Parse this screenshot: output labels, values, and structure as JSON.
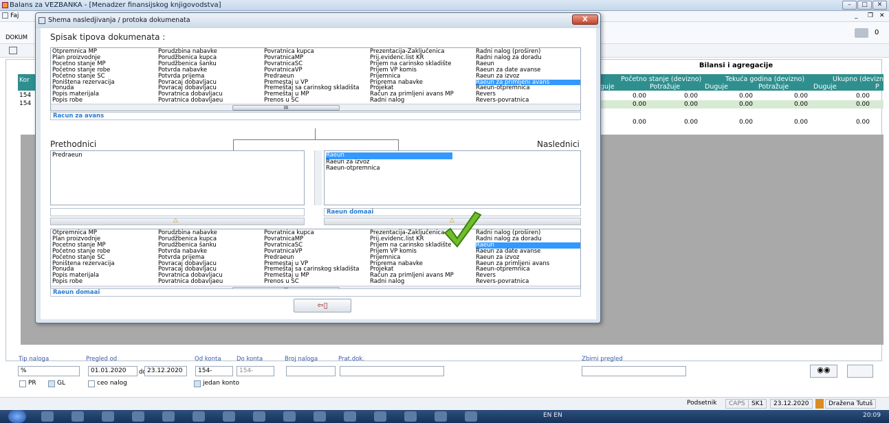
{
  "window": {
    "title": "Balans za VEZBANKA - [Menadzer finansijskog knjigovodstva]",
    "min": "–",
    "max": "□",
    "close": "✕"
  },
  "menubar": {
    "item1": "Faj",
    "mdi_min": "_",
    "mdi_max": "❐",
    "mdi_close": "✕"
  },
  "toolbar": {
    "dokum": "DOKUM",
    "messages_count": "0"
  },
  "main": {
    "bilansi_title": "Bilansi i agregacije",
    "left_head": "Kor",
    "left_rows": [
      "154",
      "154"
    ],
    "groups": [
      "Početno stanje (devizno)",
      "Tekuća godina (devizno)",
      "Ukupno (devizno)"
    ],
    "subheads": [
      "uguje",
      "Potražuje",
      "Duguje",
      "Potražuje",
      "Duguje",
      "P"
    ],
    "rows": [
      [
        "0.00",
        "0.00",
        "0.00",
        "0.00",
        "0.00"
      ],
      [
        "0.00",
        "0.00",
        "0.00",
        "0.00",
        "0.00"
      ],
      [
        "0.00",
        "0.00",
        "0.00",
        "0.00",
        "0.00"
      ]
    ]
  },
  "dialog": {
    "title": "Shema nasledjivanja / protoka dokumenata",
    "close": "X",
    "spisak_label": "Spisak tipova dokumenata :",
    "doc_columns": [
      [
        "Otpremnica MP",
        "Plan proizvodnje",
        "Pocetno stanje MP",
        "Početno stanje robe",
        "Početno stanje SC",
        "Poništena rezervacija",
        "Ponuda",
        "Popis materijala",
        "Popis robe"
      ],
      [
        "Porudzbina nabavke",
        "Porudžbenica kupca",
        "Porudžbenica šanku",
        "Potvrda nabavke",
        "Potvrda prijema",
        "Povracaj dobavljacu",
        "Povracaj dobavljacu",
        "Povratnica dobavljacu",
        "Povratnica dobavljaeu"
      ],
      [
        "Povratnica kupca",
        "PovratnicaMP",
        "PovratnicaSC",
        "PovratnicaVP",
        "Predraeun",
        "Premestaj u VP",
        "Premeštaj sa carinskog skladišta",
        "Premeštaj u MP",
        "Prenos u SC"
      ],
      [
        "Prezentacija-Zaključenica",
        "Prij.evidenc.list KR",
        "Prijem na carinsko skladište",
        "Prijem VP komis",
        "Prijemnica",
        "Priprema nabavke",
        "Projekat",
        "Račun za primljeni avans MP",
        "Radni nalog"
      ],
      [
        "Radni nalog (proširen)",
        "Radni nalog za doradu",
        "Raeun",
        "Raeun za date avanse",
        "Raeun za izvoz",
        "Raeun za primljeni avans",
        "Raeun-otpremnica",
        "Revers",
        "Revers-povratnica"
      ]
    ],
    "doc_columns_bottom_c2": [
      "Porudzbina nabavke",
      "Porudžbenica kupca",
      "Porudžbenica šanku",
      "Potvrda nabavke",
      "Potvrda prijema",
      "Povracaj dobavljacu",
      "Povracaj dobavljacu",
      "Povratnica dobavljacu",
      "Povratnica dobavljaeu"
    ],
    "doc_columns_bottom_c3": [
      "Povratnica kupca",
      "PovratnicaMP",
      "PovratnicaSC",
      "PovratnicaVP",
      "Predraeun",
      "Premestaj u VP",
      "Premeštaj sa carinskog skladišta",
      "Premeštaj u MP",
      "Prenos u SC"
    ],
    "doc_columns_bottom_c4": [
      "Prezentacija-Zaključenica",
      "Prij.evidenc.list KR",
      "Prijem na carinsko skladište",
      "Prijem VP komis",
      "Prijemnica",
      "Priprema nabavke",
      "Projekat",
      "Račun za primljeni avans MP",
      "Radni nalog"
    ],
    "doc_columns_bottom_c5": [
      "Radni nalog (proširen)",
      "Radni nalog za doradu",
      "Raeun",
      "Raeun za date avanse",
      "Raeun za izvoz",
      "Raeun za primljeni avans",
      "Raeun-otpremnica",
      "Revers",
      "Revers-povratnica"
    ],
    "top_selected": "Racun za avans",
    "prethodnici_label": "Prethodnici",
    "naslednici_label": "Naslednici",
    "prethodnici_items": [
      "Predraeun"
    ],
    "naslednici_items": [
      "Raeun",
      "Raeun za izvoz",
      "Raeun-otpremnica"
    ],
    "naslednici_selected": "Raeun domaai",
    "bottom_selected": "Raeun domaai",
    "scroll_thumb": "III",
    "exit_glyph": "⇦▯",
    "warn_glyph": "△"
  },
  "filters": {
    "tip_label": "Tip naloga",
    "tip_value": "%",
    "pregled_label": "Pregled od",
    "date_from": "01.01.2020",
    "do_label": "do",
    "date_to": "23.12.2020",
    "od_konta_label": "Od konta",
    "od_konta_value": "154-",
    "do_konta_label": "Do konta",
    "do_konta_value": "154-",
    "broj_label": "Broj naloga",
    "prat_label": "Prat.dok.",
    "zbirni_label": "Zbirni pregled",
    "pr": "PR",
    "gl": "GL",
    "ceo": "ceo nalog",
    "jedan": "jedan konto"
  },
  "status": {
    "podsetnik": "Podsetnik",
    "caps": "CAPS",
    "sk": "SK1",
    "date": "23.12.2020",
    "user": "Dražena Tutuš"
  },
  "taskbar": {
    "lang": "EN  EN",
    "time": "20:09"
  },
  "colors": {
    "teal": "#2f8f8f",
    "select": "#3399ff",
    "checkmark": "#6fbf2a"
  }
}
